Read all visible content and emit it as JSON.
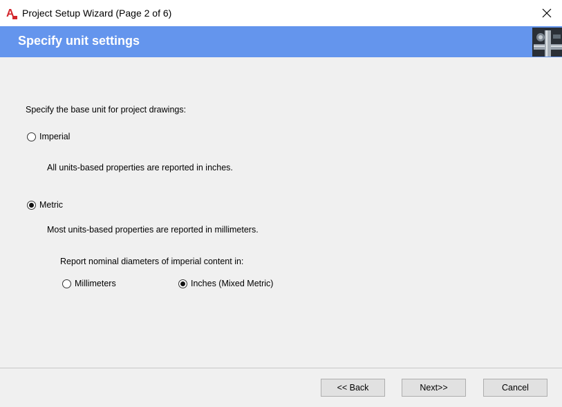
{
  "window": {
    "title": "Project Setup Wizard (Page 2 of 6)",
    "icon": "autocad-app-icon",
    "close_icon": "close-icon"
  },
  "banner": {
    "title": "Specify unit settings",
    "color": "#6495ed"
  },
  "content": {
    "prompt": "Specify the base unit for project drawings:",
    "imperial": {
      "label": "Imperial",
      "checked": false,
      "description": "All units-based properties are reported in inches."
    },
    "metric": {
      "label": "Metric",
      "checked": true,
      "description": "Most units-based properties are reported in millimeters.",
      "nominal_prompt": "Report nominal diameters of imperial content in:",
      "nominal_options": [
        {
          "label": "Millimeters",
          "checked": false
        },
        {
          "label": "Inches (Mixed Metric)",
          "checked": true
        }
      ]
    }
  },
  "buttons": {
    "back": "<< Back",
    "next": "Next>>",
    "cancel": "Cancel"
  }
}
